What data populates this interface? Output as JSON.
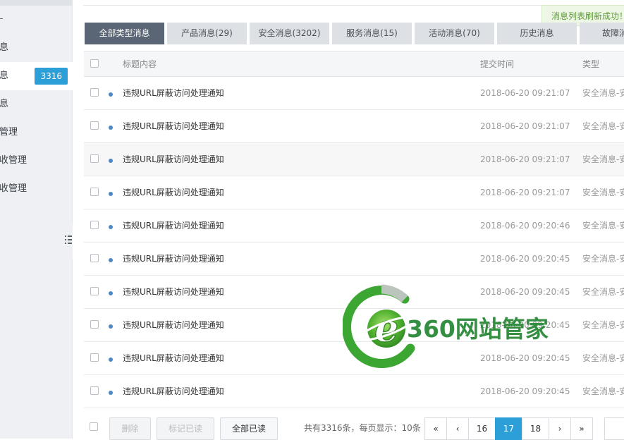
{
  "sidebar": {
    "items": [
      {
        "label": "息"
      },
      {
        "label": "息",
        "badge": "3316"
      },
      {
        "label": "息"
      },
      {
        "label": "管理"
      },
      {
        "label": "收管理"
      },
      {
        "label": "收管理"
      }
    ]
  },
  "toast": {
    "text": "消息列表刷新成功！"
  },
  "tabs": [
    {
      "label": "全部类型消息"
    },
    {
      "label": "产品消息(29)"
    },
    {
      "label": "安全消息(3202)"
    },
    {
      "label": "服务消息(15)"
    },
    {
      "label": "活动消息(70)"
    },
    {
      "label": "历史消息"
    },
    {
      "label": "故障消息"
    }
  ],
  "table": {
    "headers": {
      "title": "标题内容",
      "time": "提交时间",
      "type": "类型"
    },
    "rows": [
      {
        "title": "违规URL屏蔽访问处理通知",
        "time": "2018-06-20 09:21:07",
        "type": "安全消息-安"
      },
      {
        "title": "违规URL屏蔽访问处理通知",
        "time": "2018-06-20 09:21:07",
        "type": "安全消息-安"
      },
      {
        "title": "违规URL屏蔽访问处理通知",
        "time": "2018-06-20 09:21:07",
        "type": "安全消息-安"
      },
      {
        "title": "违规URL屏蔽访问处理通知",
        "time": "2018-06-20 09:21:07",
        "type": "安全消息-安"
      },
      {
        "title": "违规URL屏蔽访问处理通知",
        "time": "2018-06-20 09:20:46",
        "type": "安全消息-安"
      },
      {
        "title": "违规URL屏蔽访问处理通知",
        "time": "2018-06-20 09:20:45",
        "type": "安全消息-安"
      },
      {
        "title": "违规URL屏蔽访问处理通知",
        "time": "2018-06-20 09:20:45",
        "type": "安全消息-安"
      },
      {
        "title": "违规URL屏蔽访问处理通知",
        "time": "2018-06-20 09:20:45",
        "type": "安全消息-安"
      },
      {
        "title": "违规URL屏蔽访问处理通知",
        "time": "2018-06-20 09:20:45",
        "type": "安全消息-安"
      },
      {
        "title": "违规URL屏蔽访问处理通知",
        "time": "2018-06-20 09:20:45",
        "type": "安全消息-安"
      }
    ]
  },
  "footer": {
    "delete_label": "删除",
    "mark_read_label": "标记已读",
    "all_read_label": "全部已读",
    "total_text": "共有3316条，每页显示：10条"
  },
  "pager": {
    "first": "«",
    "prev": "‹",
    "pages": [
      "16",
      "17",
      "18"
    ],
    "current": "17",
    "next": "›",
    "last": "»"
  },
  "watermark": {
    "text": "360网站管家"
  },
  "colors": {
    "accent": "#2d9fd8",
    "tab_active": "#5a6575",
    "dot": "#4e88c4",
    "watermark": "#2e8c3c"
  }
}
